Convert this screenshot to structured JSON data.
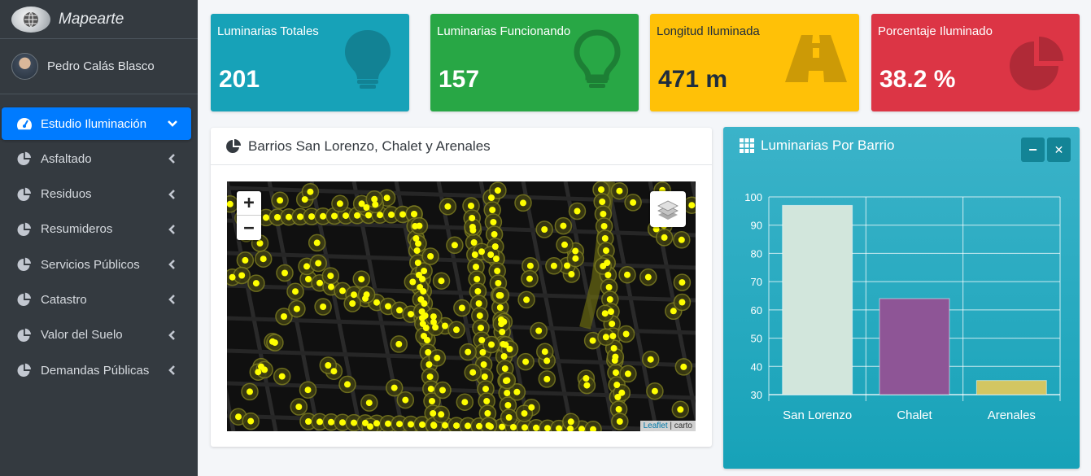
{
  "brand": {
    "name": "Mapearte"
  },
  "user": {
    "name": "Pedro Calás Blasco"
  },
  "sidebar": {
    "items": [
      {
        "label": "Estudio Iluminación",
        "active": true,
        "icon": "gauge-icon"
      },
      {
        "label": "Asfaltado",
        "icon": "pie-chart-icon"
      },
      {
        "label": "Residuos",
        "icon": "pie-chart-icon"
      },
      {
        "label": "Resumideros",
        "icon": "pie-chart-icon"
      },
      {
        "label": "Servicios Públicos",
        "icon": "pie-chart-icon"
      },
      {
        "label": "Catastro",
        "icon": "pie-chart-icon"
      },
      {
        "label": "Valor del Suelo",
        "icon": "pie-chart-icon"
      },
      {
        "label": "Demandas Públicas",
        "icon": "pie-chart-icon"
      }
    ]
  },
  "info_boxes": [
    {
      "title": "Luminarias Totales",
      "value": "201",
      "color": "#17a2b8",
      "icon": "lightbulb-icon"
    },
    {
      "title": "Luminarias Funcionando",
      "value": "157",
      "color": "#28a745",
      "icon": "lightbulb-outline-icon"
    },
    {
      "title": "Longitud Iluminada",
      "value": "471 m",
      "color": "#ffc107",
      "icon": "road-icon"
    },
    {
      "title": "Porcentaje Iluminado",
      "value": "38.2 %",
      "color": "#dc3545",
      "icon": "pie-chart-icon"
    }
  ],
  "map_card": {
    "title": "Barrios San Lorenzo, Chalet y Arenales",
    "zoom_in": "+",
    "zoom_out": "−",
    "attribution_link": "Leaflet",
    "attribution_sep": " | ",
    "attribution_text": "carto"
  },
  "chart_card": {
    "title": "Luminarias Por Barrio",
    "minimize": "−",
    "close": "✕"
  },
  "chart_data": {
    "type": "bar",
    "categories": [
      "San Lorenzo",
      "Chalet",
      "Arenales"
    ],
    "values": [
      97,
      64,
      35
    ],
    "colors": [
      "#d2e6dc",
      "#8e5596",
      "#d3c662"
    ],
    "ylim": [
      30,
      100
    ],
    "yticks": [
      30,
      40,
      50,
      60,
      70,
      80,
      90,
      100
    ],
    "grid": true
  }
}
